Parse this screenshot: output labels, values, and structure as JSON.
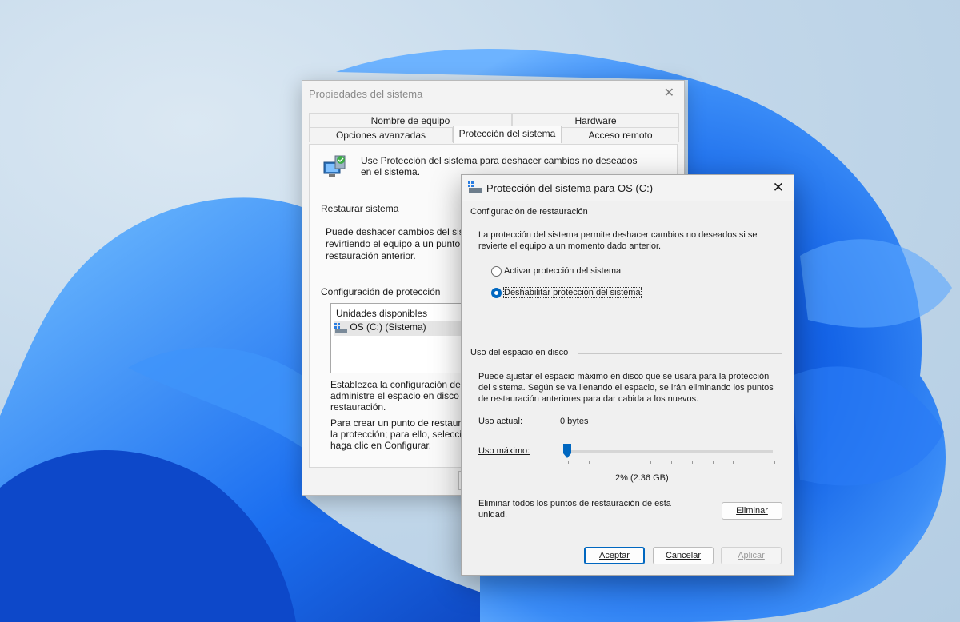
{
  "colors": {
    "accent": "#0067c0",
    "wallpaper_blue": "#1a6cf0"
  },
  "back_window": {
    "title": "Propiedades del sistema",
    "close_icon": "close-icon",
    "tabs_row1": [
      "Nombre de equipo",
      "Hardware"
    ],
    "tabs_row2": [
      "Opciones avanzadas",
      "Protección del sistema",
      "Acceso remoto"
    ],
    "active_tab": "Protección del sistema",
    "intro_line1": "Use Protección del sistema para deshacer cambios no deseados",
    "intro_line2": "en el sistema.",
    "restore_label": "Restaurar sistema",
    "restore_line1": "Puede deshacer cambios del sis",
    "restore_line2": "revirtiendo el equipo a un punto c",
    "restore_line3": "restauración anterior.",
    "protection_label": "Configuración de protección",
    "list_header": "Unidades disponibles",
    "list_item": "OS (C:) (Sistema)",
    "config_line1": "Establezca la configuración de",
    "config_line2": "administre el espacio en disco",
    "config_line3": "restauración.",
    "create_line1": "Para crear un punto de restaura",
    "create_line2": "la protección; para ello, selecci",
    "create_line3": "haga clic en Configurar."
  },
  "dialog": {
    "title": "Protección del sistema para OS (C:)",
    "restore_section": "Configuración de restauración",
    "restore_desc_line1": "La protección del sistema permite deshacer cambios no deseados si se",
    "restore_desc_line2": "revierte el equipo a un momento dado anterior.",
    "radio_enable": "Activar protección del sistema",
    "radio_disable": "Deshabilitar protección del sistema",
    "selected_option": "Deshabilitar protección del sistema",
    "disk_section": "Uso del espacio en disco",
    "disk_desc_line1": "Puede ajustar el espacio máximo en disco que se usará para la protección",
    "disk_desc_line2": "del sistema. Según se va llenando el espacio, se irán eliminando los puntos",
    "disk_desc_line3": "de restauración anteriores para dar cabida a los nuevos.",
    "current_usage_label": "Uso actual:",
    "current_usage_value": "0 bytes",
    "max_usage_label": "Uso máximo:",
    "max_usage_percent": 2,
    "max_usage_text": "2% (2.36 GB)",
    "delete_line1": "Eliminar todos los puntos de restauración de esta",
    "delete_line2": "unidad.",
    "delete_button": "Eliminar",
    "ok_button": "Aceptar",
    "cancel_button": "Cancelar",
    "apply_button": "Aplicar"
  }
}
